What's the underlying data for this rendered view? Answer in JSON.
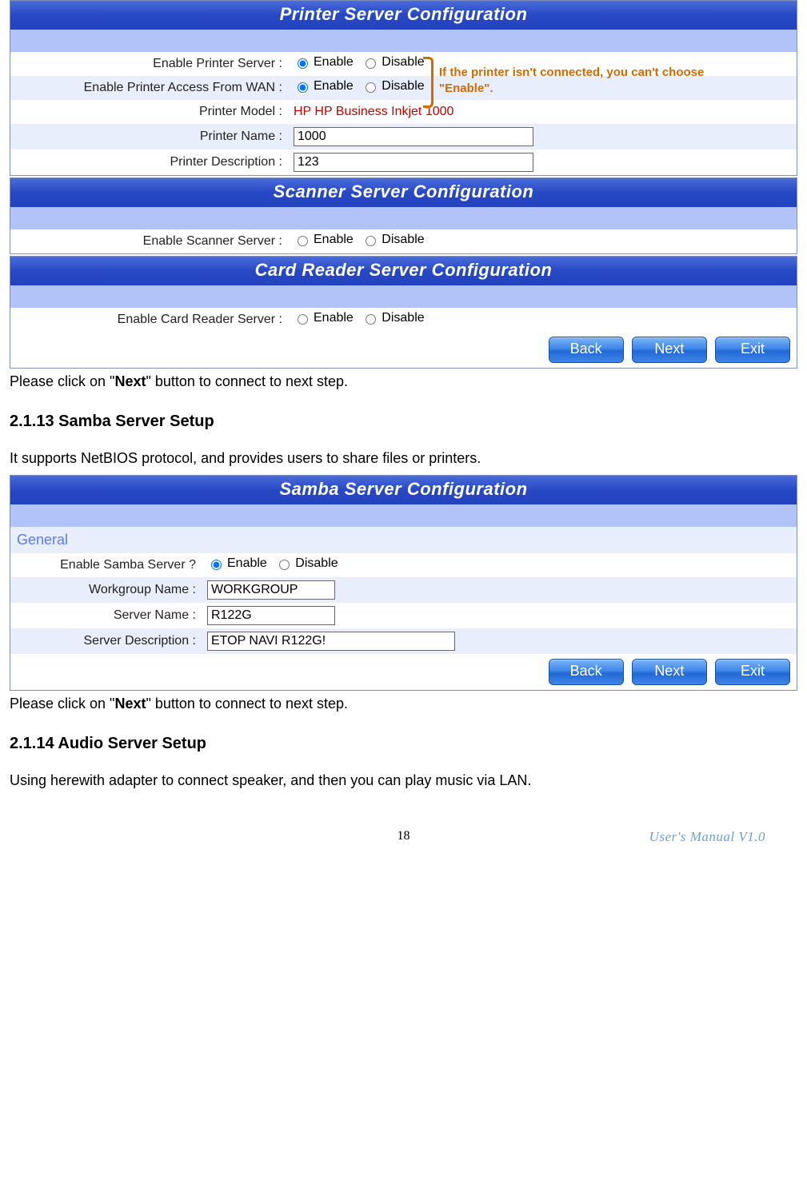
{
  "printer": {
    "title": "Printer Server Configuration",
    "rows": {
      "enable_label": "Enable Printer Server :",
      "wan_label": "Enable Printer Access From WAN :",
      "model_label": "Printer Model :",
      "name_label": "Printer Name :",
      "desc_label": "Printer Description :",
      "model_value": "HP HP Business Inkjet 1000",
      "name_value": "1000",
      "desc_value": "123"
    },
    "opt_enable": "Enable",
    "opt_disable": "Disable",
    "callout": "If the printer isn't connected, you can't choose \"Enable\"."
  },
  "scanner": {
    "title": "Scanner Server Configuration",
    "label": "Enable Scanner Server :",
    "opt_enable": "Enable",
    "opt_disable": "Disable"
  },
  "cardreader": {
    "title": "Card Reader Server Configuration",
    "label": "Enable Card Reader Server :",
    "opt_enable": "Enable",
    "opt_disable": "Disable"
  },
  "buttons": {
    "back": "Back",
    "next": "Next",
    "exit": "Exit"
  },
  "note1_a": "Please click on \"",
  "note1_b": "Next",
  "note1_c": "\" button to connect to next step.",
  "heading213": "2.1.13   Samba Server Setup",
  "samba_intro": "It supports NetBIOS protocol, and provides users to share files or printers.",
  "samba": {
    "title": "Samba Server Configuration",
    "general": "General",
    "enable_label": "Enable Samba Server ?",
    "workgroup_label": "Workgroup Name :",
    "server_label": "Server Name :",
    "desc_label": "Server Description :",
    "workgroup_value": "WORKGROUP",
    "server_value": "R122G",
    "desc_value": "ETOP NAVI R122G!",
    "opt_enable": "Enable",
    "opt_disable": "Disable"
  },
  "note2_a": "Please click on \"",
  "note2_b": "Next",
  "note2_c": "\" button to connect to next step.",
  "heading214": "2.1.14   Audio Server Setup",
  "audio_intro": "Using herewith adapter to connect speaker, and then you can play music via LAN.",
  "footer": {
    "page": "18",
    "version": "User's Manual V1.0"
  }
}
